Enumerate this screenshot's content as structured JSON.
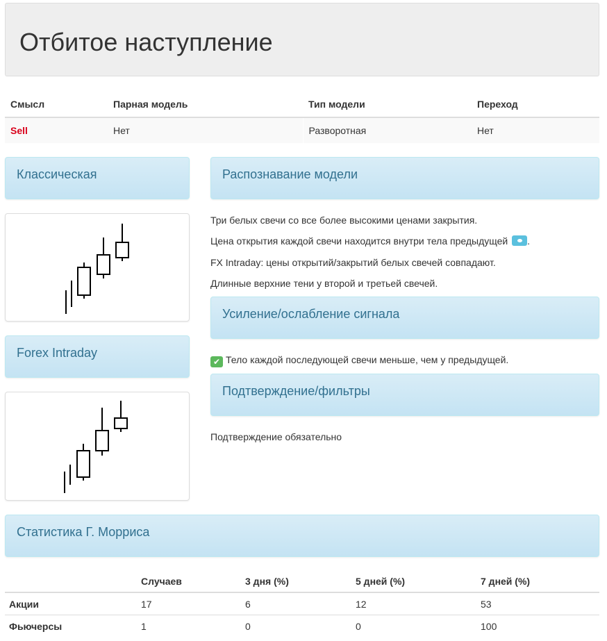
{
  "header": {
    "title": "Отбитое наступление"
  },
  "meta_table": {
    "headers": [
      "Смысл",
      "Парная модель",
      "Тип модели",
      "Переход"
    ],
    "row": [
      "Sell",
      "Нет",
      "Разворотная",
      "Нет"
    ]
  },
  "panels": {
    "classic": "Классическая",
    "forex": "Forex Intraday",
    "recognition": "Распознавание модели",
    "strength": "Усиление/ослабление сигнала",
    "confirmation": "Подтверждение/фильтры",
    "stats": "Статистика Г. Морриса"
  },
  "recognition": {
    "line1": "Три белых свечи со все более высокими ценами закрытия.",
    "line2": "Цена открытия каждой свечи находится внутри тела предыдущей",
    "line2_end": ".",
    "line3": "FX Intraday: цены открытий/закрытий белых свечей совпадают.",
    "line4": "Длинные верхние тени у второй и третьей свечей."
  },
  "strength": {
    "item": "Тело каждой последующей свечи меньше, чем у предыдущей."
  },
  "confirmation": {
    "text": "Подтверждение обязательно"
  },
  "stats_table": {
    "headers": [
      "",
      "Случаев",
      "3 дня (%)",
      "5 дней (%)",
      "7 дней (%)"
    ],
    "rows": [
      [
        "Акции",
        "17",
        "6",
        "12",
        "53"
      ],
      [
        "Фьючерсы",
        "1",
        "0",
        "0",
        "100"
      ]
    ]
  },
  "colors": {
    "sell": "#d9001b",
    "panel_text": "#31708f",
    "panel_bg": "#d9edf7",
    "check": "#5cb85c",
    "info": "#5bc0de"
  },
  "icons": {
    "info": "comment-bubble-icon",
    "check": "checkbox-checked-icon"
  }
}
